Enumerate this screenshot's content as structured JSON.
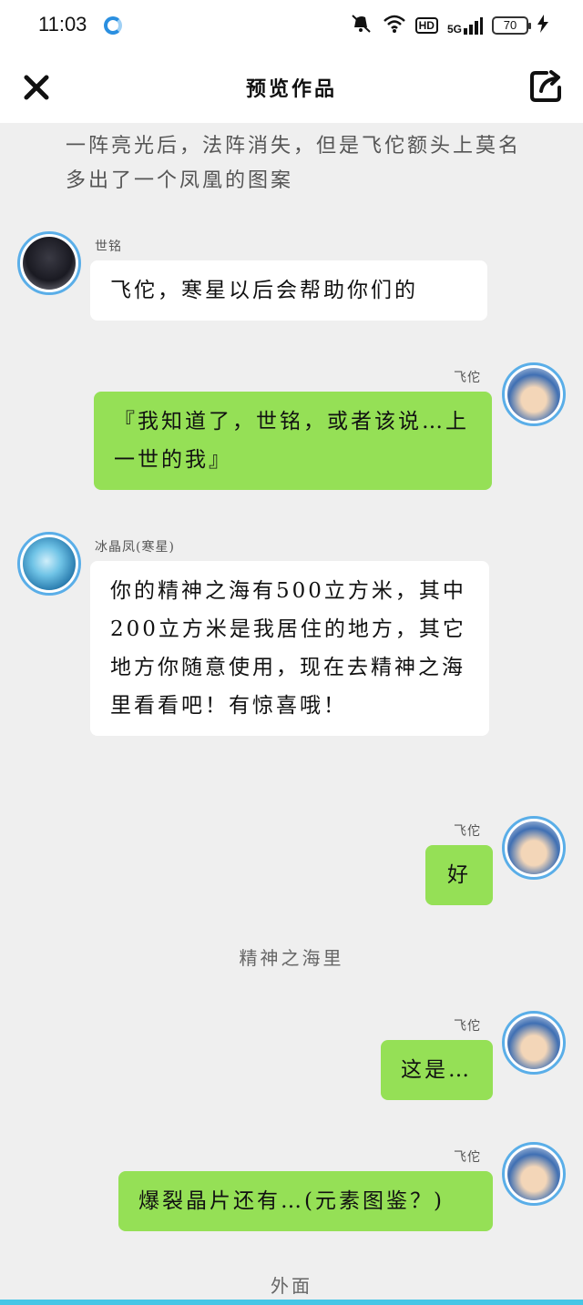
{
  "status_bar": {
    "time": "11:03",
    "hd": "HD",
    "network": "5G",
    "battery": "70"
  },
  "header": {
    "title": "预览作品"
  },
  "narration": {
    "line1": "一阵亮光后，法阵消失，但是飞佗额头上莫名多出了一个凤凰的图案",
    "line2": "精神之海里",
    "line3": "外面"
  },
  "messages": [
    {
      "side": "left",
      "name": "世铭",
      "text": "飞佗，寒星以后会帮助你们的"
    },
    {
      "side": "right",
      "name": "飞佗",
      "text": "『我知道了，世铭，或者该说…上一世的我』"
    },
    {
      "side": "left",
      "name": "冰晶凤(寒星)",
      "text": "你的精神之海有500立方米，其中200立方米是我居住的地方，其它地方你随意使用，现在去精神之海里看看吧！有惊喜哦！"
    },
    {
      "side": "right",
      "name": "飞佗",
      "text": "好"
    },
    {
      "side": "right",
      "name": "飞佗",
      "text": "这是…"
    },
    {
      "side": "right",
      "name": "飞佗",
      "text": "爆裂晶片还有…(元素图鉴？)"
    }
  ],
  "colors": {
    "right_bubble": "#95e056",
    "left_bubble": "#ffffff",
    "avatar_ring": "#5aaee8",
    "background": "#efefef"
  }
}
